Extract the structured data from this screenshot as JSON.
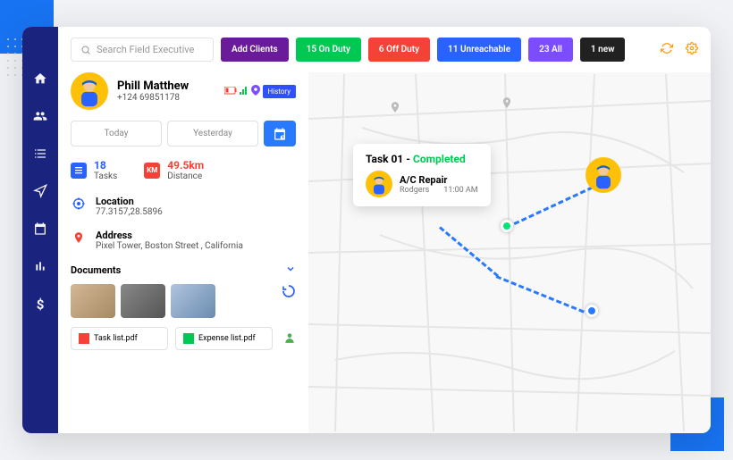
{
  "search": {
    "placeholder": "Search Field Executive"
  },
  "topbar": {
    "add_clients": "Add Clients",
    "on_duty": "15 On Duty",
    "off_duty": "6 Off Duty",
    "unreachable": "11 Unreachable",
    "all": "23 All",
    "new": "1 new"
  },
  "profile": {
    "name": "Phill Matthew",
    "phone": "+124 69851178",
    "history": "History"
  },
  "tabs": {
    "today": "Today",
    "yesterday": "Yesterday"
  },
  "stats": {
    "tasks": {
      "value": "18",
      "label": "Tasks"
    },
    "distance": {
      "value": "49.5km",
      "label": "Distance"
    },
    "distance_icon": "KM"
  },
  "location": {
    "label": "Location",
    "value": "77.3157,28.5896"
  },
  "address": {
    "label": "Address",
    "value": "Pixel Tower, Boston Street , California"
  },
  "documents": {
    "title": "Documents"
  },
  "files": {
    "task_list": "Task list.pdf",
    "expense_list": "Expense list.pdf"
  },
  "popup": {
    "title": "Task 01 -",
    "status": "Completed",
    "job": "A/C Repair",
    "customer": "Rodgers",
    "time": "11:00 AM"
  }
}
